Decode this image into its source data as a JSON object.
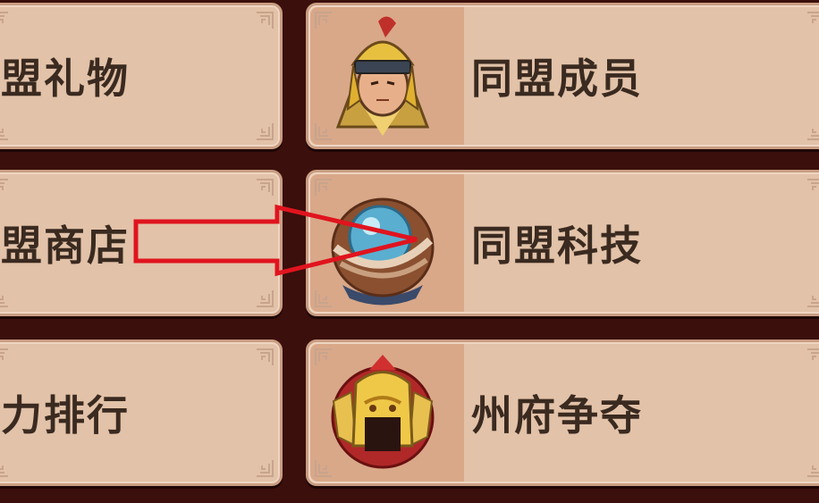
{
  "left_column": [
    {
      "label": "盟礼物"
    },
    {
      "label": "盟商店"
    },
    {
      "label": "力排行"
    }
  ],
  "right_column": [
    {
      "label": "同盟成员",
      "icon": "general-helmet-icon"
    },
    {
      "label": "同盟科技",
      "icon": "blue-orb-icon"
    },
    {
      "label": "州府争夺",
      "icon": "golden-lion-helmet-icon"
    }
  ],
  "annotation": {
    "type": "arrow",
    "color": "#e0141e"
  },
  "colors": {
    "background": "#3a0f0c",
    "panel": "#e2c2a8",
    "panel_border": "#c99d82",
    "icon_box": "#d9a889",
    "text": "#3a2a20"
  }
}
